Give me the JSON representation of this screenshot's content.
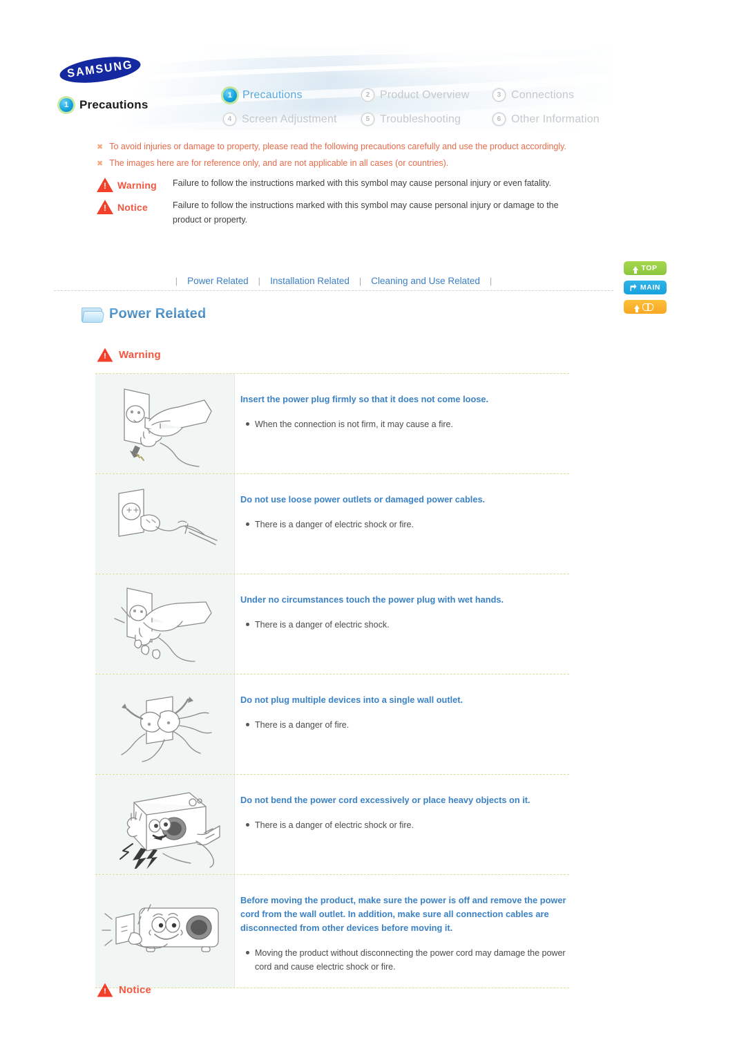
{
  "brand": {
    "logo_text": "SAMSUNG"
  },
  "breadcrumb": {
    "number": "1",
    "label": "Precautions"
  },
  "top_nav": {
    "items": [
      {
        "number": "1",
        "label": "Precautions",
        "current": true
      },
      {
        "number": "2",
        "label": "Product Overview",
        "current": false
      },
      {
        "number": "3",
        "label": "Connections",
        "current": false
      },
      {
        "number": "4",
        "label": "Screen Adjustment",
        "current": false
      },
      {
        "number": "5",
        "label": "Troubleshooting",
        "current": false
      },
      {
        "number": "6",
        "label": "Other Information",
        "current": false
      }
    ]
  },
  "intro": {
    "note_mark": "✖",
    "note1": "To avoid injuries or damage to property, please read the following precautions carefully and use the product accordingly.",
    "note2": "The images here are for reference only, and are not applicable in all cases (or countries).",
    "symbols": [
      {
        "name": "Warning",
        "description": "Failure to follow the instructions marked with this symbol may cause personal injury or even fatality."
      },
      {
        "name": "Notice",
        "description": "Failure to follow the instructions marked with this symbol may cause personal injury or damage to the product or property."
      }
    ]
  },
  "sub_nav": {
    "separator": "|",
    "links": [
      "Power Related",
      "Installation Related",
      "Cleaning and Use Related"
    ]
  },
  "side_buttons": [
    {
      "label": "TOP",
      "icon": "arrow-up-icon",
      "color": "#8cc63f"
    },
    {
      "label": "MAIN",
      "icon": "arrow-main-icon",
      "color": "#17a2de"
    },
    {
      "label": "",
      "icon": "index-book-icon",
      "color": "#f9a825"
    }
  ],
  "section": {
    "title": "Power Related",
    "folder_icon": "folder-icon",
    "warning_label": "Warning",
    "notice_label": "Notice"
  },
  "precautions": [
    {
      "image": "hand-inserting-plug-into-outlet",
      "title": "Insert the power plug firmly so that it does not come loose.",
      "bullets": [
        "When the connection is not firm, it may cause a fire."
      ]
    },
    {
      "image": "loose-outlet-damaged-cable",
      "title": "Do not use loose power outlets or damaged power cables.",
      "bullets": [
        "There is a danger of electric shock or fire."
      ]
    },
    {
      "image": "wet-hand-touching-plug",
      "title": "Under no circumstances touch the power plug with wet hands.",
      "bullets": [
        "There is a danger of electric shock."
      ]
    },
    {
      "image": "multiple-plugs-single-outlet",
      "title": "Do not plug multiple devices into a single wall outlet.",
      "bullets": [
        "There is a danger of fire."
      ]
    },
    {
      "image": "projector-on-bent-power-cord",
      "title": "Do not bend the power cord excessively or place heavy objects on it.",
      "bullets": [
        "There is a danger of electric shock or fire."
      ]
    },
    {
      "image": "unplug-projector-before-moving",
      "title": "Before moving the product, make sure the power is off and remove the power cord from the wall outlet. In addition, make sure all connection cables are disconnected from other devices before moving it.",
      "bullets": [
        "Moving the product without disconnecting the power cord may damage the power cord and cause electric shock or fire."
      ]
    }
  ]
}
